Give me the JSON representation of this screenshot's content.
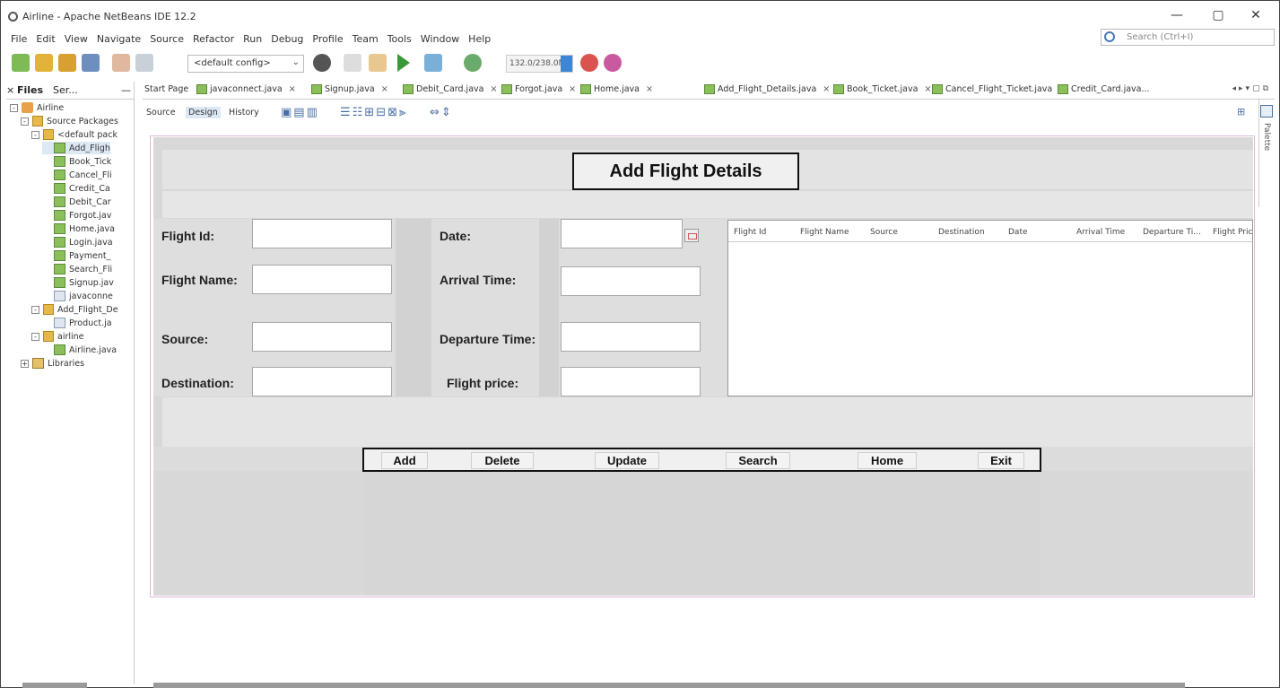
{
  "window": {
    "title": "Airline - Apache NetBeans IDE 12.2",
    "controls": [
      "—",
      "▢",
      "✕"
    ]
  },
  "menu": [
    "File",
    "Edit",
    "View",
    "Navigate",
    "Source",
    "Refactor",
    "Run",
    "Debug",
    "Profile",
    "Team",
    "Tools",
    "Window",
    "Help"
  ],
  "search": {
    "placeholder": "Search (Ctrl+I)"
  },
  "toolbar": {
    "config": "<default config>",
    "memory": "132.0/238.0MB"
  },
  "left_panel": {
    "tabs": [
      "Files",
      "Ser..."
    ],
    "tree": [
      {
        "label": "Airline",
        "type": "project",
        "indent": 0,
        "expander": "-"
      },
      {
        "label": "Source Packages",
        "type": "package",
        "indent": 1,
        "expander": "-"
      },
      {
        "label": "<default pack",
        "type": "package",
        "indent": 2,
        "expander": "-"
      },
      {
        "label": "Add_Fligh",
        "type": "form",
        "indent": 3,
        "selected": true
      },
      {
        "label": "Book_Tick",
        "type": "form",
        "indent": 3
      },
      {
        "label": "Cancel_Fli",
        "type": "form",
        "indent": 3
      },
      {
        "label": "Credit_Ca",
        "type": "form",
        "indent": 3
      },
      {
        "label": "Debit_Car",
        "type": "form",
        "indent": 3
      },
      {
        "label": "Forgot.jav",
        "type": "form",
        "indent": 3
      },
      {
        "label": "Home.java",
        "type": "form",
        "indent": 3
      },
      {
        "label": "Login.java",
        "type": "form",
        "indent": 3
      },
      {
        "label": "Payment_",
        "type": "form",
        "indent": 3
      },
      {
        "label": "Search_Fli",
        "type": "form",
        "indent": 3
      },
      {
        "label": "Signup.jav",
        "type": "form",
        "indent": 3
      },
      {
        "label": "javaconne",
        "type": "java",
        "indent": 3
      },
      {
        "label": "Add_Flight_De",
        "type": "package",
        "indent": 2,
        "expander": "-"
      },
      {
        "label": "Product.ja",
        "type": "java",
        "indent": 3
      },
      {
        "label": "airline",
        "type": "package",
        "indent": 2,
        "expander": "-"
      },
      {
        "label": "Airline.java",
        "type": "form",
        "indent": 3
      },
      {
        "label": "Libraries",
        "type": "lib",
        "indent": 1,
        "expander": "+"
      }
    ]
  },
  "editor_tabs": [
    {
      "label": "Start Page",
      "icon": false
    },
    {
      "label": "javaconnect.java",
      "icon": true
    },
    {
      "label": "Signup.java",
      "icon": true
    },
    {
      "label": "Debit_Card.java",
      "icon": true
    },
    {
      "label": "Forgot.java",
      "icon": true
    },
    {
      "label": "Home.java",
      "icon": true
    },
    {
      "label": "Add_Flight_Details.java",
      "icon": true,
      "active": true
    },
    {
      "label": "Book_Ticket.java",
      "icon": true
    },
    {
      "label": "Cancel_Flight_Ticket.java",
      "icon": true
    },
    {
      "label": "Credit_Card.java...",
      "icon": true
    }
  ],
  "editor_subtabs": [
    "Source",
    "Design",
    "History"
  ],
  "palette_label": "Palette",
  "form": {
    "title": "Add Flight Details",
    "labels": {
      "flight_id": "Flight Id:",
      "flight_name": "Flight Name:",
      "source": "Source:",
      "destination": "Destination:",
      "date": "Date:",
      "arrival_time": "Arrival Time:",
      "departure_time": "Departure Time:",
      "flight_price": "Flight price:"
    },
    "table_columns": [
      "Flight Id",
      "Flight Name",
      "Source",
      "Destination",
      "Date",
      "Arrival Time",
      "Departure Ti...",
      "Flight Pric"
    ],
    "buttons": {
      "add": "Add",
      "delete": "Delete",
      "update": "Update",
      "search": "Search",
      "home": "Home",
      "exit": "Exit"
    }
  }
}
